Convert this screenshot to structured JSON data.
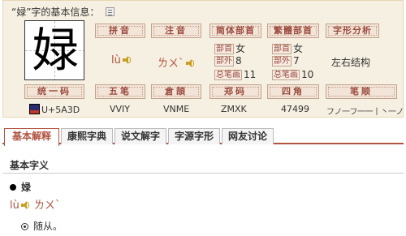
{
  "title": "“娽”字的基本信息：",
  "character": "娽",
  "labels": {
    "pinyin": "拼音",
    "zhuyin": "注音",
    "simp_radical": "简体部首",
    "trad_radical": "繁體部首",
    "structure": "字形分析",
    "unicode": "统一码",
    "wubi": "五笔",
    "cangjie": "倉頡",
    "zhengma": "郑码",
    "sijiao": "四角",
    "stroke_order": "笔顺"
  },
  "tags": {
    "radical": "部首",
    "outer": "部外",
    "total": "总笔画"
  },
  "values": {
    "pinyin": "lù",
    "zhuyin": "ㄌㄨˋ",
    "simp_radical": "女",
    "simp_outer": "8",
    "simp_total": "11",
    "trad_radical": "女",
    "trad_outer": "7",
    "trad_total": "10",
    "structure": "左右结构",
    "unicode": "U+5A3D",
    "wubi": "VVIY",
    "cangjie": "VNME",
    "zhengma": "ZMXK",
    "sijiao": "47499",
    "stroke_order": "フノ一フ一一丨丶一ノ丶"
  },
  "tabs": [
    "基本解释",
    "康熙字典",
    "说文解字",
    "字源字形",
    "网友讨论"
  ],
  "section_title": "基本字义",
  "entry": {
    "char": "娽",
    "pinyin": "lù",
    "zhuyin": "ㄌㄨˋ",
    "definition": "随从。"
  },
  "icons": [
    "doc-icon",
    "speaker-icon",
    "unicode-logo-icon",
    "bullet-icon",
    "circle-bullet-icon"
  ],
  "colors": {
    "accent": "#b0533f",
    "panel_bg": "#f6f0e2",
    "label_bg": "#f2e4d7",
    "speaker": "#c99d1c"
  }
}
